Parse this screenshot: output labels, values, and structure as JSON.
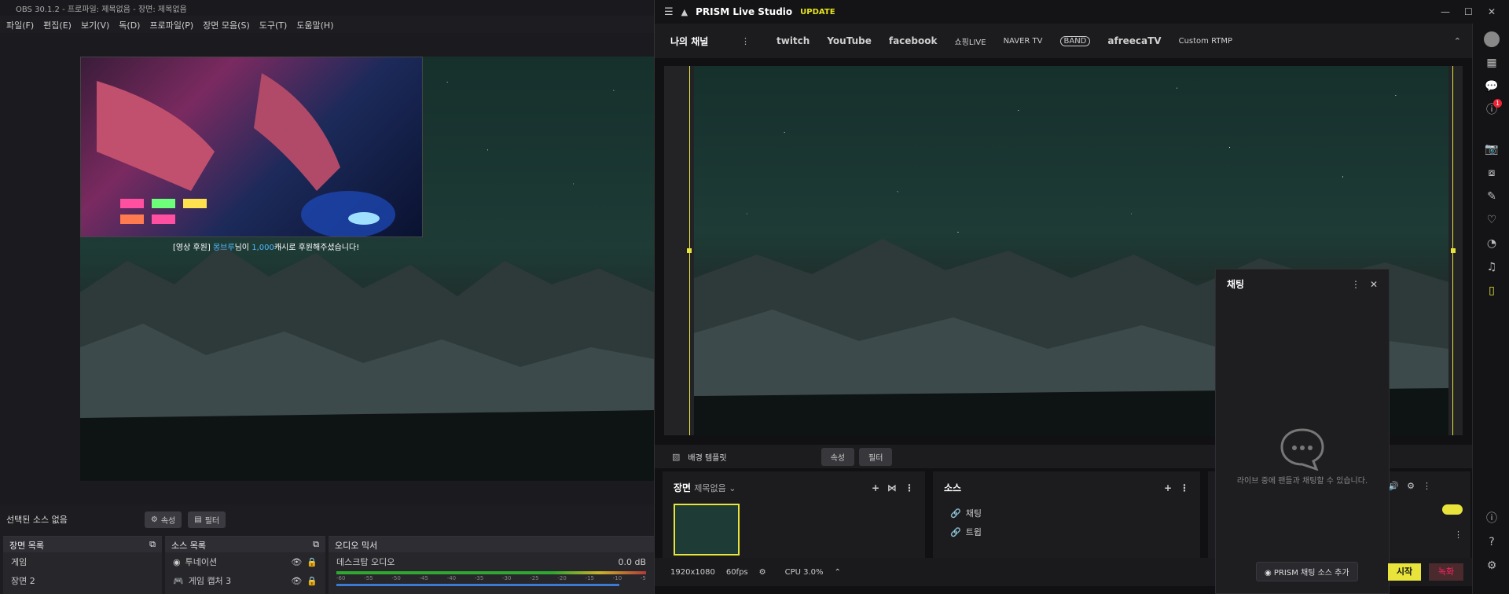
{
  "obs": {
    "title": "OBS 30.1.2 - 프로파일: 제목없음 - 장면: 제목없음",
    "menu": [
      "파일(F)",
      "편집(E)",
      "보기(V)",
      "독(D)",
      "프로파일(P)",
      "장면 모음(S)",
      "도구(T)",
      "도움말(H)"
    ],
    "donation_prefix": "[영상 후원]",
    "donation_name": "몽브루",
    "donation_mid": "님이",
    "donation_amount": "1,000",
    "donation_suffix": "캐시로 후원해주셨습니다!",
    "no_source": "선택된 소스 없음",
    "properties_btn": "속성",
    "filters_btn": "필터",
    "scene_list_title": "장면 목록",
    "scenes": [
      "게임",
      "장면 2"
    ],
    "source_list_title": "소스 목록",
    "sources": [
      "투네이션",
      "게임 캡처 3"
    ],
    "mixer_title": "오디오 믹서",
    "mixer_channel": "데스크탑 오디오",
    "mixer_db": "0.0 dB",
    "mixer_scale": [
      "-60",
      "-55",
      "-50",
      "-45",
      "-40",
      "-35",
      "-30",
      "-25",
      "-20",
      "-15",
      "-10",
      "-5"
    ]
  },
  "prism": {
    "app_title": "PRISM Live Studio",
    "update_badge": "UPDATE",
    "channels_title": "나의 채널",
    "platforms": [
      "twitch",
      "YouTube",
      "facebook",
      "쇼핑LIVE",
      "NAVER TV",
      "BAND",
      "afreecaTV",
      "Custom RTMP"
    ],
    "bg_template": "배경 템플릿",
    "props_btn": "속성",
    "filter_btn": "필터",
    "scene_label": "장면",
    "scene_name": "제목없음",
    "source_label": "소스",
    "sources": [
      "채팅",
      "트윕"
    ],
    "resolution": "1920x1080",
    "fps": "60fps",
    "cpu": "CPU 3.0%",
    "start_btn": "시작",
    "record_btn": "녹화",
    "notification_count": "1"
  },
  "chat": {
    "title": "채팅",
    "empty_text": "라이브 중에 팬들과 채팅할 수 있습니다.",
    "add_source_btn": "PRISM 채팅 소스 추가"
  },
  "colors": {
    "accent": "#e8e43c",
    "record": "#ff2266"
  }
}
